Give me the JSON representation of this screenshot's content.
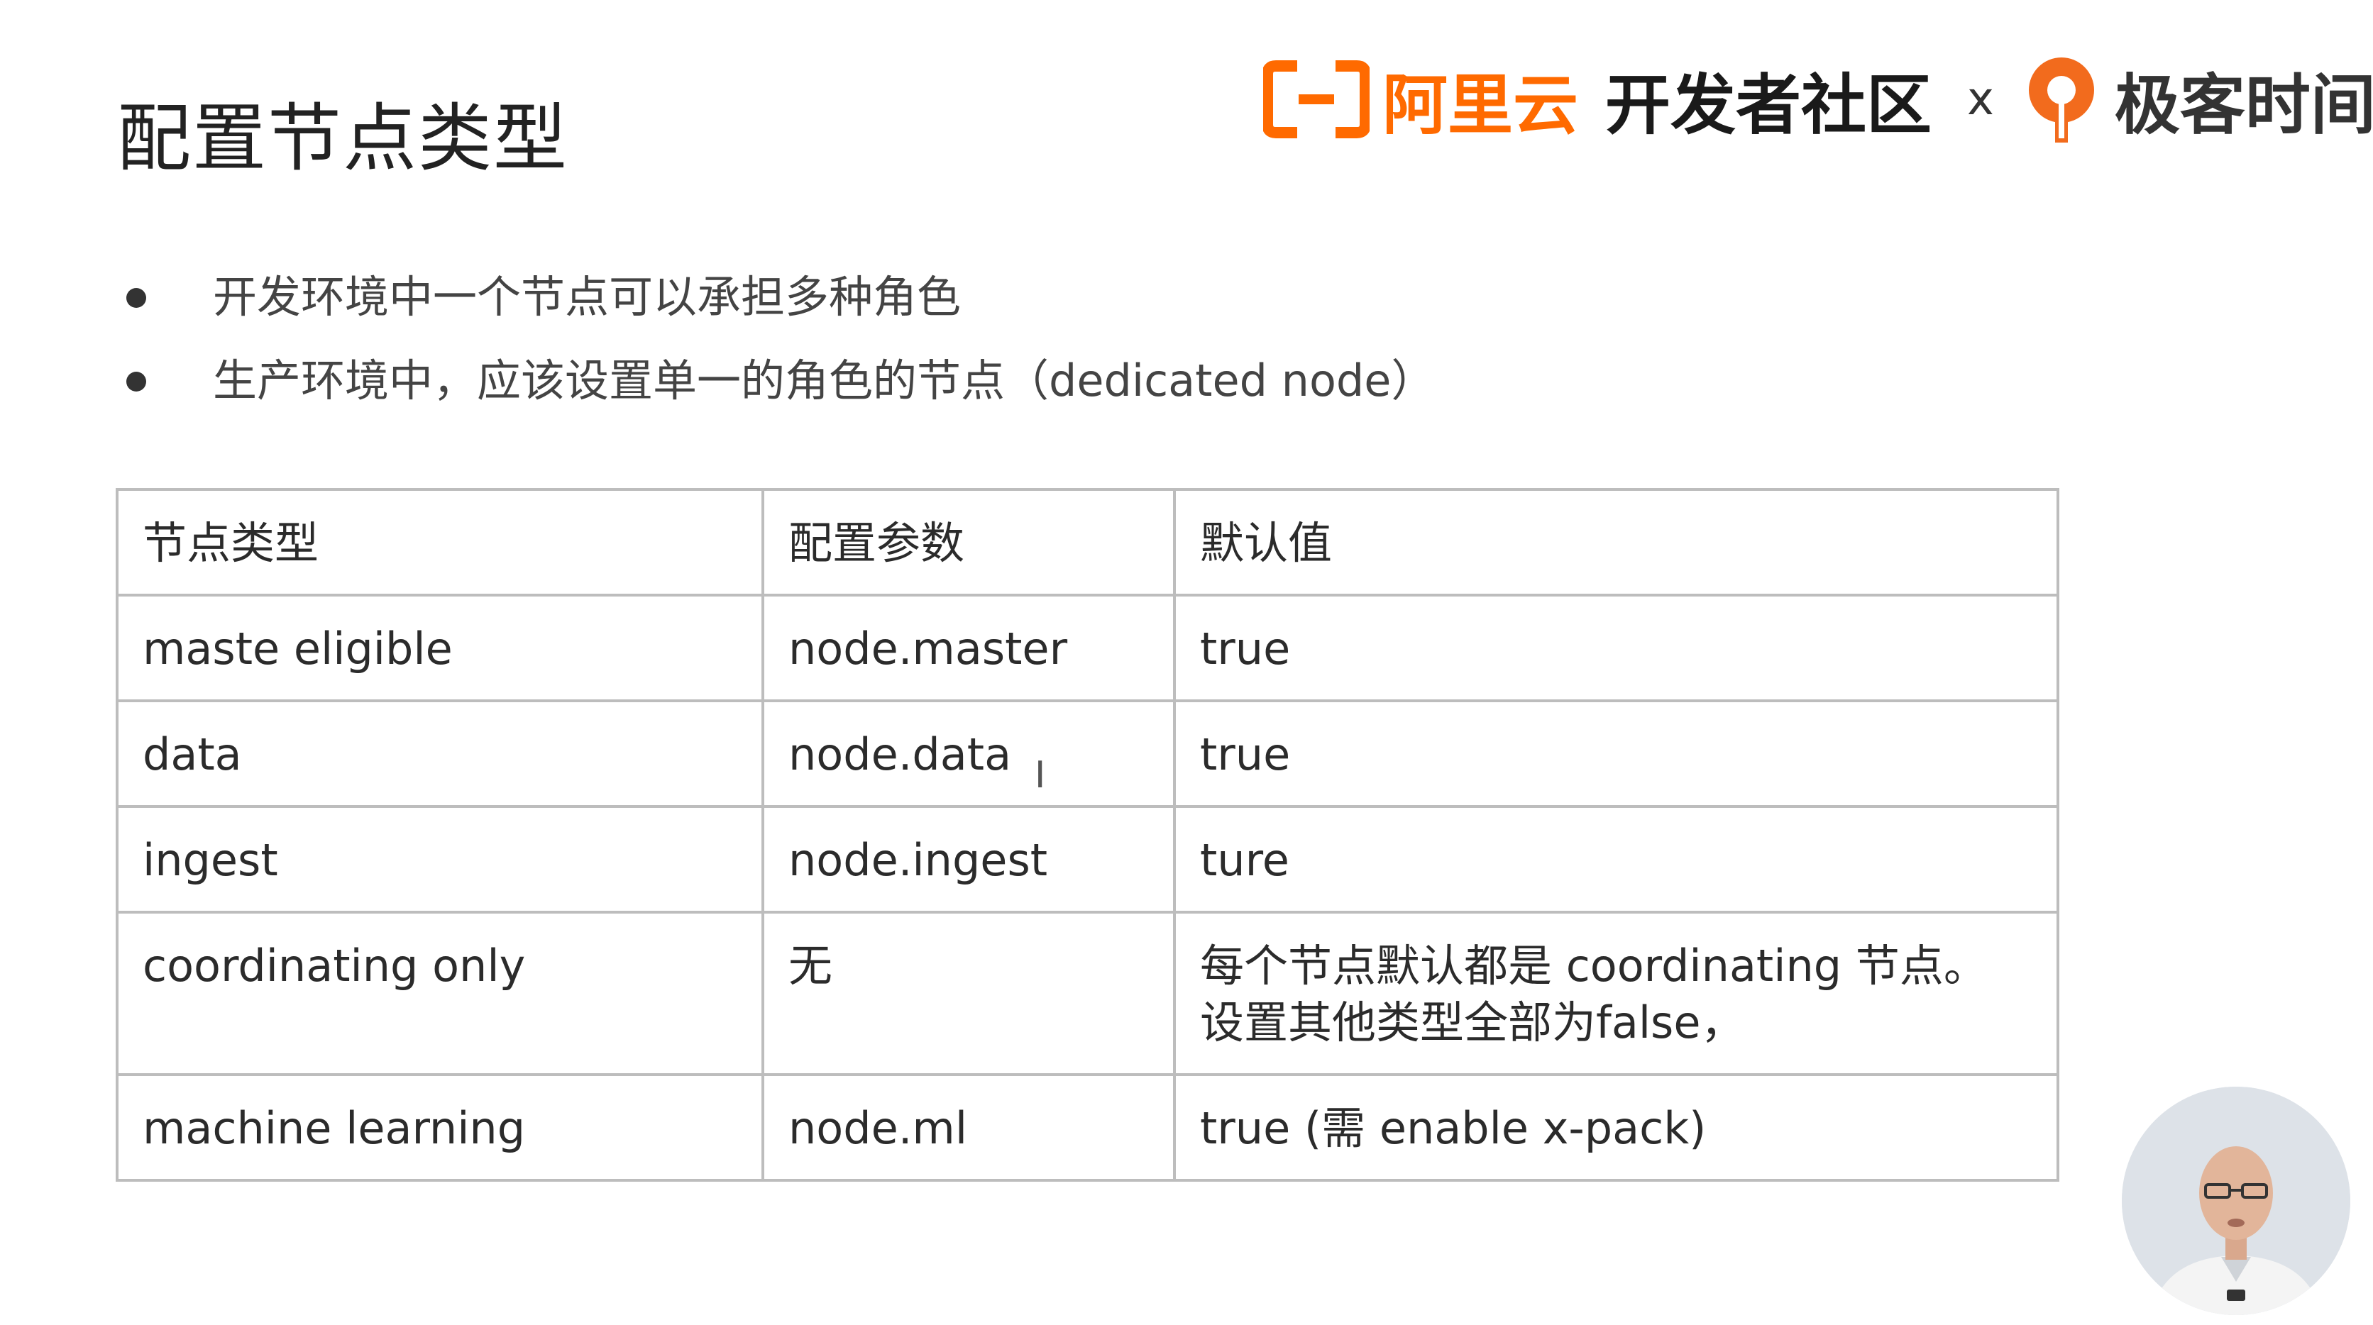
{
  "slide": {
    "title": "配置节点类型"
  },
  "branding": {
    "aliyun": "阿里云",
    "community": "开发者社区",
    "separator": "x",
    "geektime": "极客时间"
  },
  "bullets": [
    "开发环境中一个节点可以承担多种角色",
    "生产环境中，应该设置单一的角色的节点（dedicated node）"
  ],
  "table": {
    "headers": [
      "节点类型",
      "配置参数",
      "默认值"
    ],
    "rows": [
      [
        "maste eligible",
        "node.master",
        "true"
      ],
      [
        "data",
        "node.data",
        "true"
      ],
      [
        "ingest",
        "node.ingest",
        "ture"
      ],
      [
        "coordinating only",
        "无",
        "每个节点默认都是 coordinating 节点。",
        "设置其他类型全部为false，"
      ],
      [
        "machine learning",
        "node.ml",
        "true (需 enable x-pack)"
      ]
    ]
  },
  "icons": {
    "cursor": "text-cursor-icon",
    "speaker": "speaker-video-icon"
  },
  "colors": {
    "aliyun_orange": "#ff6a00",
    "geektime_orange": "#f26b1d",
    "table_border": "#bdbdbd"
  }
}
